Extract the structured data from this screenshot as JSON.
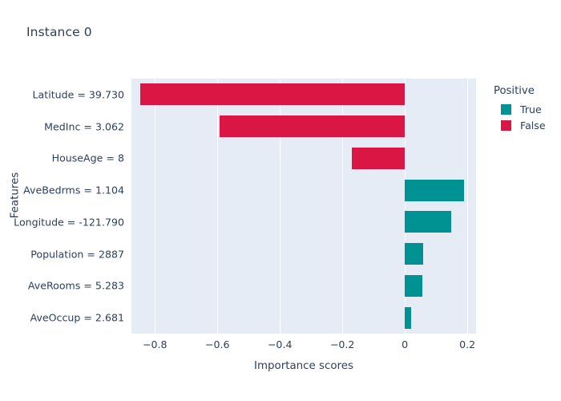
{
  "chart_data": {
    "type": "bar",
    "orientation": "horizontal",
    "title": "Instance 0",
    "xlabel": "Importance scores",
    "ylabel": "Features",
    "categories": [
      "Latitude = 39.730",
      "MedInc = 3.062",
      "HouseAge = 8",
      "AveBedrms = 1.104",
      "Longitude = -121.790",
      "Population = 2887",
      "AveRooms = 5.283",
      "AveOccup = 2.681"
    ],
    "values": [
      -0.846,
      -0.592,
      -0.169,
      0.19,
      0.149,
      0.059,
      0.056,
      0.021
    ],
    "point_groups": [
      "False",
      "False",
      "False",
      "True",
      "True",
      "True",
      "True",
      "True"
    ],
    "xlim": [
      -0.875,
      0.228
    ],
    "xticks": [
      "−0.8",
      "−0.6",
      "−0.4",
      "−0.2",
      "0",
      "0.2"
    ],
    "xtick_values": [
      -0.8,
      -0.6,
      -0.4,
      -0.2,
      0,
      0.2
    ],
    "grid": true,
    "grid_axis": "x",
    "legend": {
      "title": "Positive",
      "position": "right",
      "entries": [
        {
          "label": "True",
          "color": "#009193"
        },
        {
          "label": "False",
          "color": "#d91644"
        }
      ]
    },
    "colors": {
      "positive_true": "#009193",
      "negative_false": "#d91644",
      "plot_background": "#e5ecf6",
      "paper_background": "#ffffff",
      "text": "#2a3f5f",
      "gridline": "#ffffff"
    }
  }
}
